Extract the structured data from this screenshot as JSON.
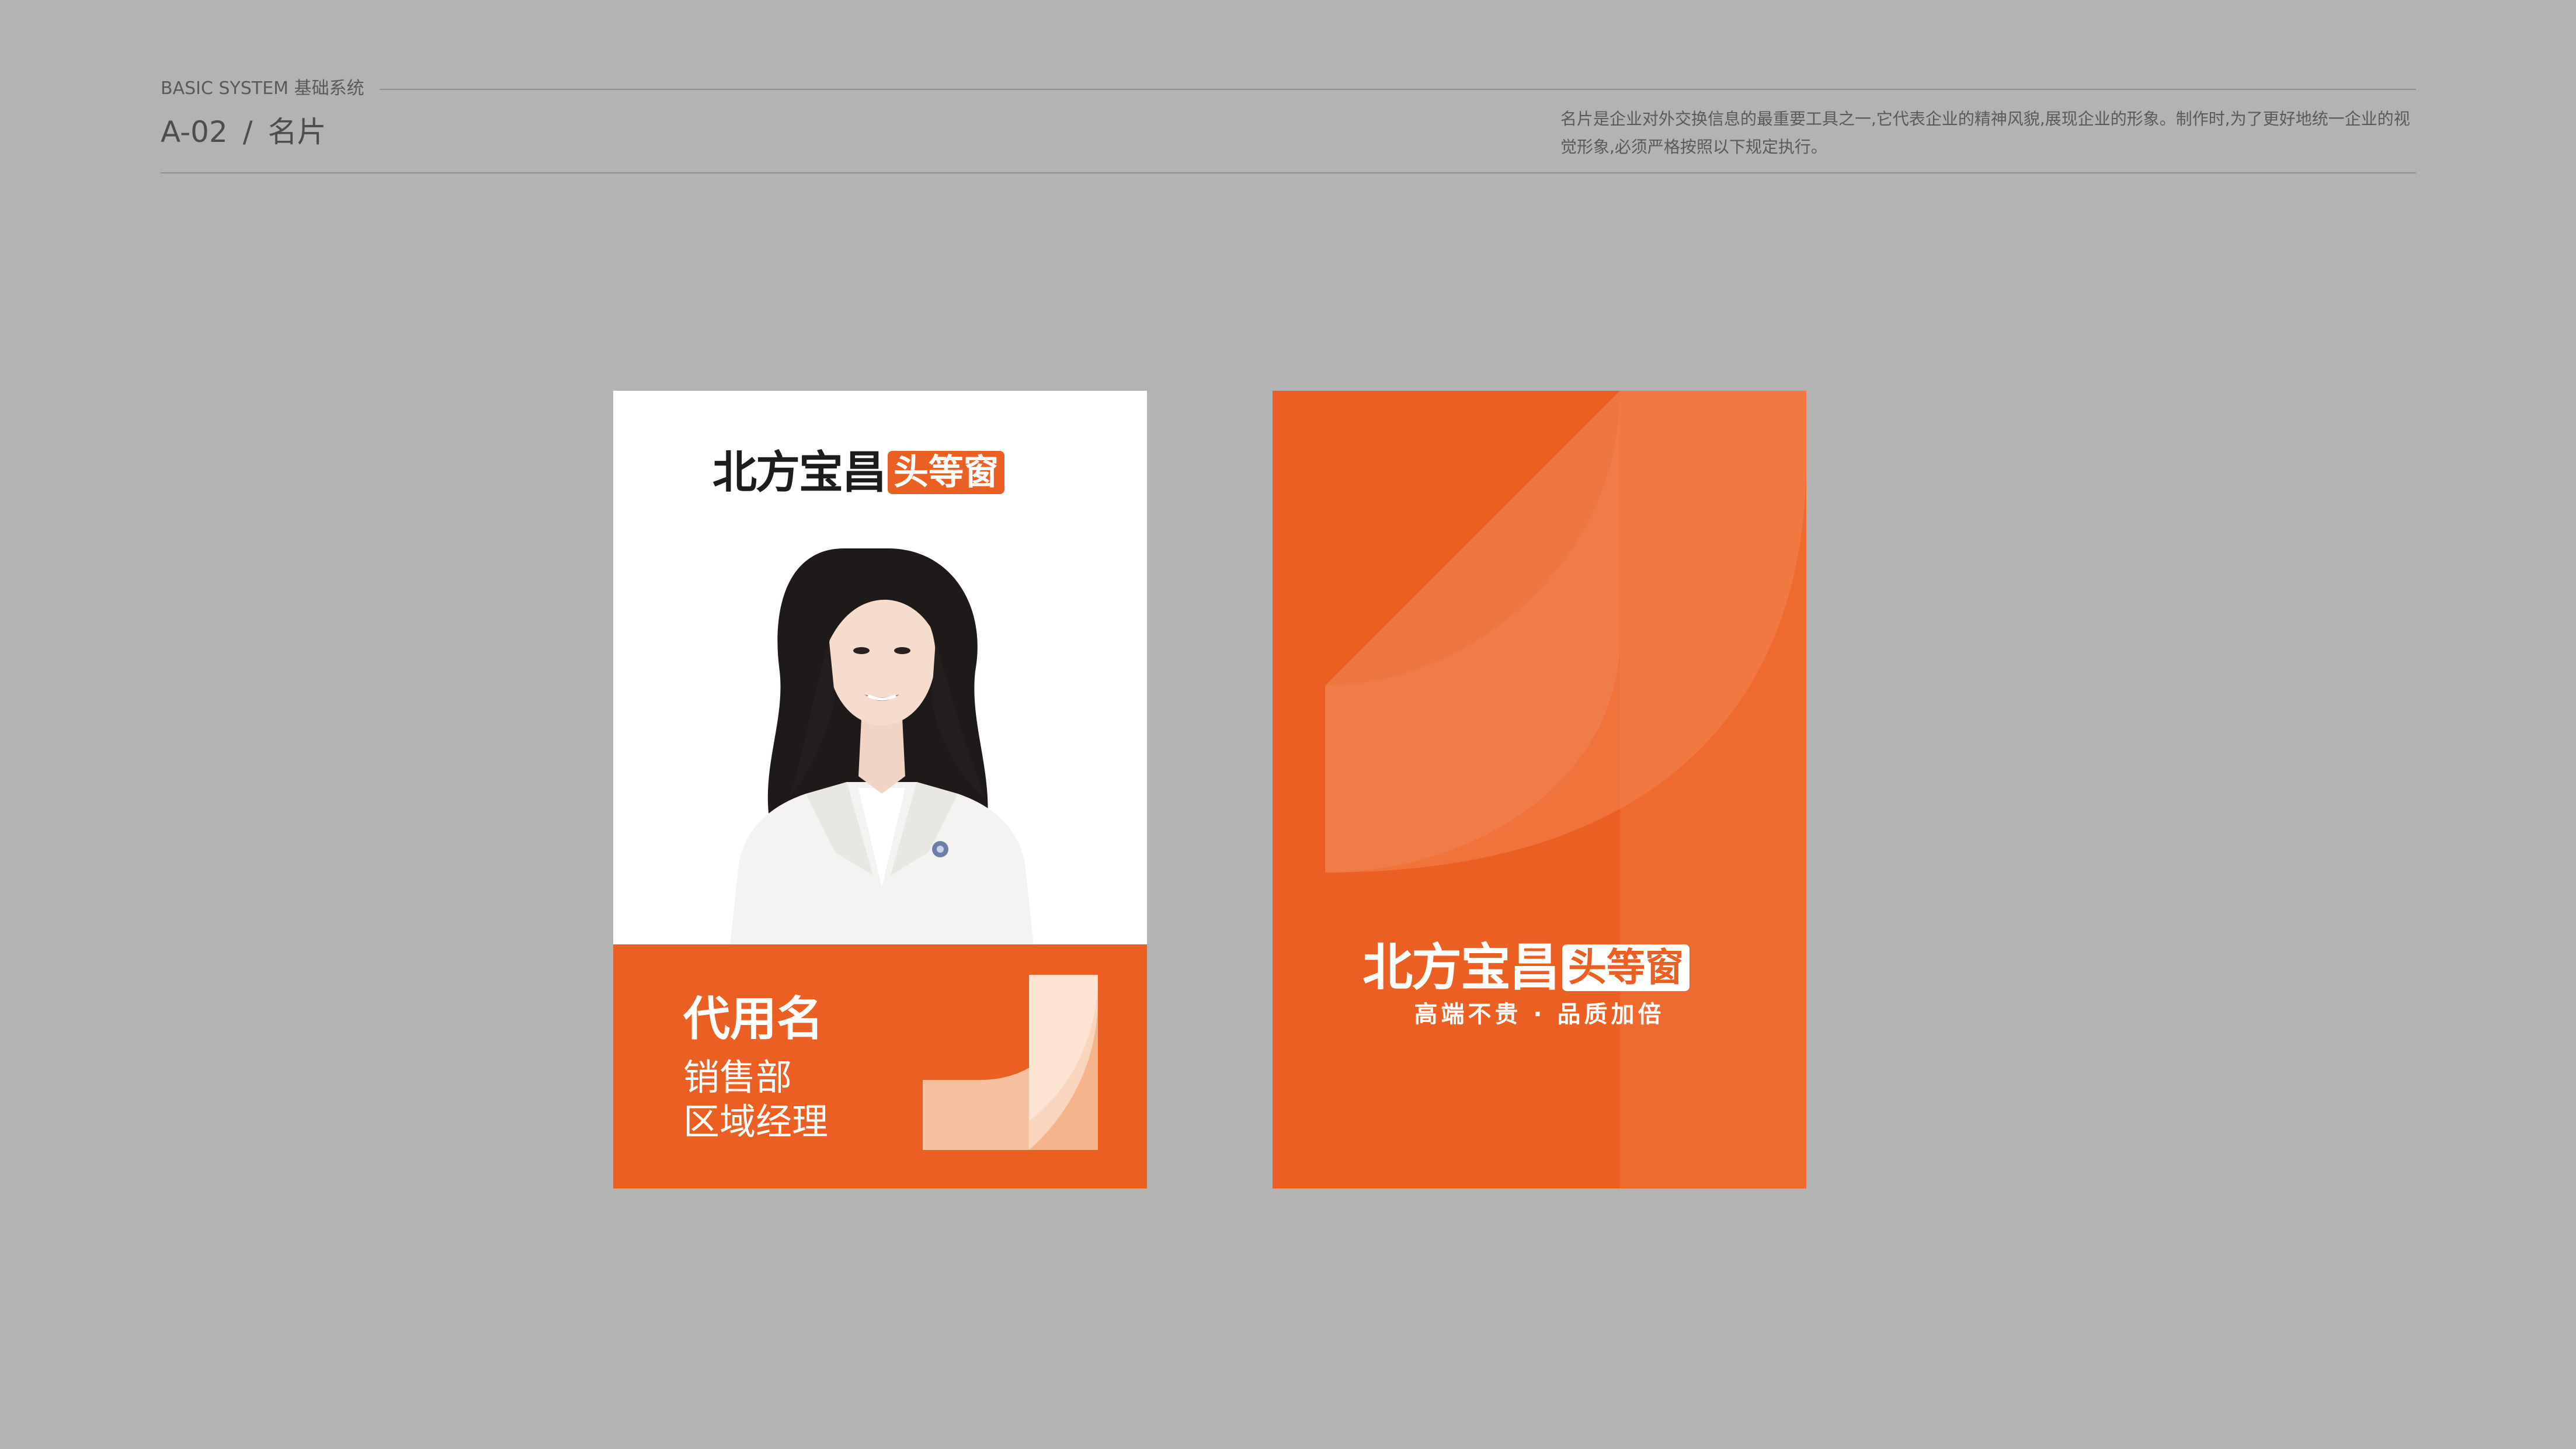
{
  "header": {
    "system_label": "BASIC SYSTEM 基础系统",
    "section_code": "A-02",
    "separator": "/",
    "section_title": "名片",
    "description": "名片是企业对外交换信息的最重要工具之一,它代表企业的精神风貌,展现企业的形象。制作时,为了更好地统一企业的视觉形象,必须严格按照以下规定执行。"
  },
  "brand": {
    "name": "北方宝昌",
    "tag": "头等窗",
    "slogan": "高端不贵 · 品质加倍",
    "accent_color": "#ec5f22"
  },
  "front_card": {
    "person_name": "代用名",
    "department": "销售部",
    "job_title": "区域经理"
  }
}
